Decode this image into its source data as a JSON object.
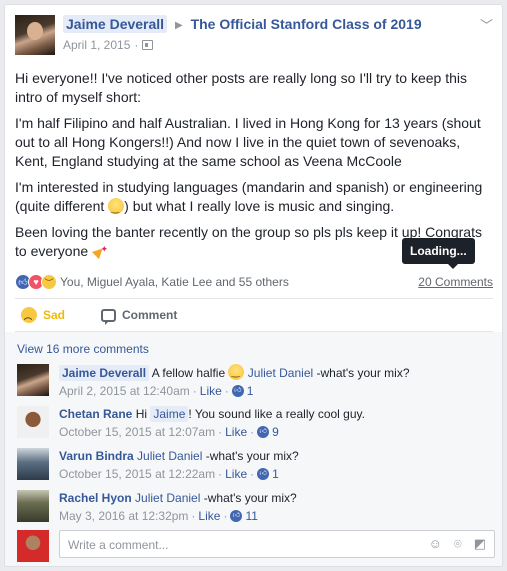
{
  "post": {
    "author": "Jaime Deverall",
    "group": "The Official Stanford Class of 2019",
    "date": "April 1, 2015",
    "paragraphs": [
      "Hi everyone!! I've noticed other posts are really long so I'll try to keep this intro of myself short:",
      "I'm half Filipino and half Australian. I lived in Hong Kong for 13 years (shout out to all Hong Kongers!!) And now I live in the quiet town of sevenoaks, Kent, England studying at the same school as Veena McCoole",
      "I'm interested in studying languages (mandarin and spanish) or engineering (quite different ",
      ") but what I really love is music and singing.",
      "Been loving the banter recently on the group so pls pls keep it up! Congrats to everyone "
    ]
  },
  "reactions": {
    "summary": "You, Miguel Ayala, Katie Lee and 55 others",
    "comments_count": "20 Comments",
    "tooltip": "Loading..."
  },
  "actions": {
    "sad_label": "Sad",
    "comment_label": "Comment"
  },
  "comments": {
    "view_more": "View 16 more comments",
    "items": [
      {
        "name": "Jaime Deverall",
        "text_before": "A fellow halfie ",
        "tag": "Juliet Daniel",
        "text_after": " -what's your mix?",
        "time": "April 2, 2015 at 12:40am",
        "like": "Like",
        "count": "1"
      },
      {
        "name": "Chetan Rane",
        "text_before": "Hi ",
        "tag": "Jaime",
        "text_after": "! You sound like a really cool guy.",
        "time": "October 15, 2015 at 12:07am",
        "like": "Like",
        "count": "9"
      },
      {
        "name": "Varun Bindra",
        "text_before": "",
        "tag": "Juliet Daniel",
        "text_after": " -what's your mix?",
        "time": "October 15, 2015 at 12:22am",
        "like": "Like",
        "count": "1"
      },
      {
        "name": "Rachel Hyon",
        "text_before": "",
        "tag": "Juliet Daniel",
        "text_after": " -what's your mix?",
        "time": "May 3, 2016 at 12:32pm",
        "like": "Like",
        "count": "11"
      }
    ],
    "compose_placeholder": "Write a comment...",
    "separator": "·"
  },
  "icons": {
    "header_menu": "chevron-down-icon",
    "audience": "audience-icon",
    "like": "like-reaction-icon",
    "love": "love-reaction-icon",
    "sad": "sad-reaction-icon",
    "compose": [
      "emoji-icon",
      "camera-icon",
      "sticker-icon"
    ]
  },
  "colors": {
    "link": "#365899",
    "like_blue": "#4267b2",
    "sad_yellow": "#f0ba00",
    "meta_gray": "#90949c"
  }
}
